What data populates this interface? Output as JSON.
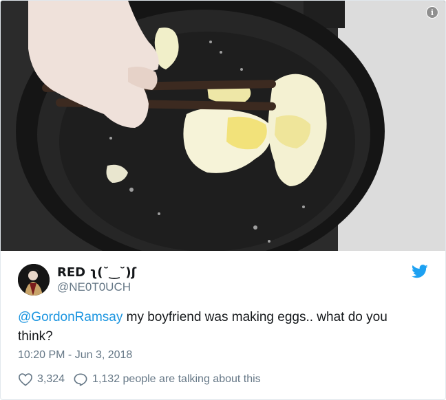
{
  "media": {
    "alt_icon": "info-icon",
    "info_glyph": "i"
  },
  "author": {
    "display_name": "RED ʅ(˘‿˘)ʃ",
    "handle": "@NE0T0UCH",
    "avatar_icon": "avatar"
  },
  "brand": {
    "icon": "twitter-bird-icon",
    "color": "#1da1f2"
  },
  "tweet": {
    "mention": "@GordonRamsay",
    "text": " my boyfriend was making eggs.. what do you think?",
    "timestamp": "10:20 PM - Jun 3, 2018"
  },
  "actions": {
    "likes": "3,324",
    "talking": "1,132 people are talking about this",
    "like_icon": "heart-icon",
    "reply_icon": "speech-bubble-icon"
  },
  "colors": {
    "mention": "#1b95e0",
    "secondary_text": "#657786",
    "border": "#e1e8ed"
  }
}
